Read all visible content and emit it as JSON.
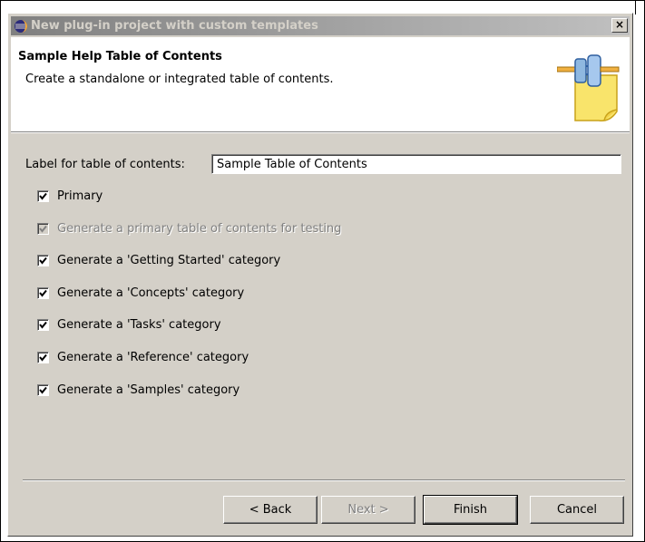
{
  "window": {
    "title": "New plug-in project with custom templates",
    "close_glyph": "×"
  },
  "banner": {
    "title": "Sample Help Table of Contents",
    "description": "Create a standalone or integrated table of contents.",
    "graphic_icon": "plug-in-wizard-icon"
  },
  "form": {
    "label": "Label for table of contents:",
    "value": "Sample Table of Contents"
  },
  "checkboxes": [
    {
      "label": "Primary",
      "checked": true,
      "enabled": true
    },
    {
      "label": "Generate a primary table of contents for testing",
      "checked": true,
      "enabled": false
    },
    {
      "label": "Generate a 'Getting Started' category",
      "checked": true,
      "enabled": true
    },
    {
      "label": "Generate a 'Concepts' category",
      "checked": true,
      "enabled": true
    },
    {
      "label": "Generate a 'Tasks' category",
      "checked": true,
      "enabled": true
    },
    {
      "label": "Generate a 'Reference' category",
      "checked": true,
      "enabled": true
    },
    {
      "label": "Generate a 'Samples' category",
      "checked": true,
      "enabled": true
    }
  ],
  "buttons": {
    "back": "< Back",
    "next": "Next >",
    "finish": "Finish",
    "cancel": "Cancel"
  },
  "colors": {
    "dialog_bg": "#d4d0c8",
    "inactive_title_start": "#808080",
    "inactive_title_end": "#c0c0c0",
    "banner_bg": "#ffffff"
  }
}
